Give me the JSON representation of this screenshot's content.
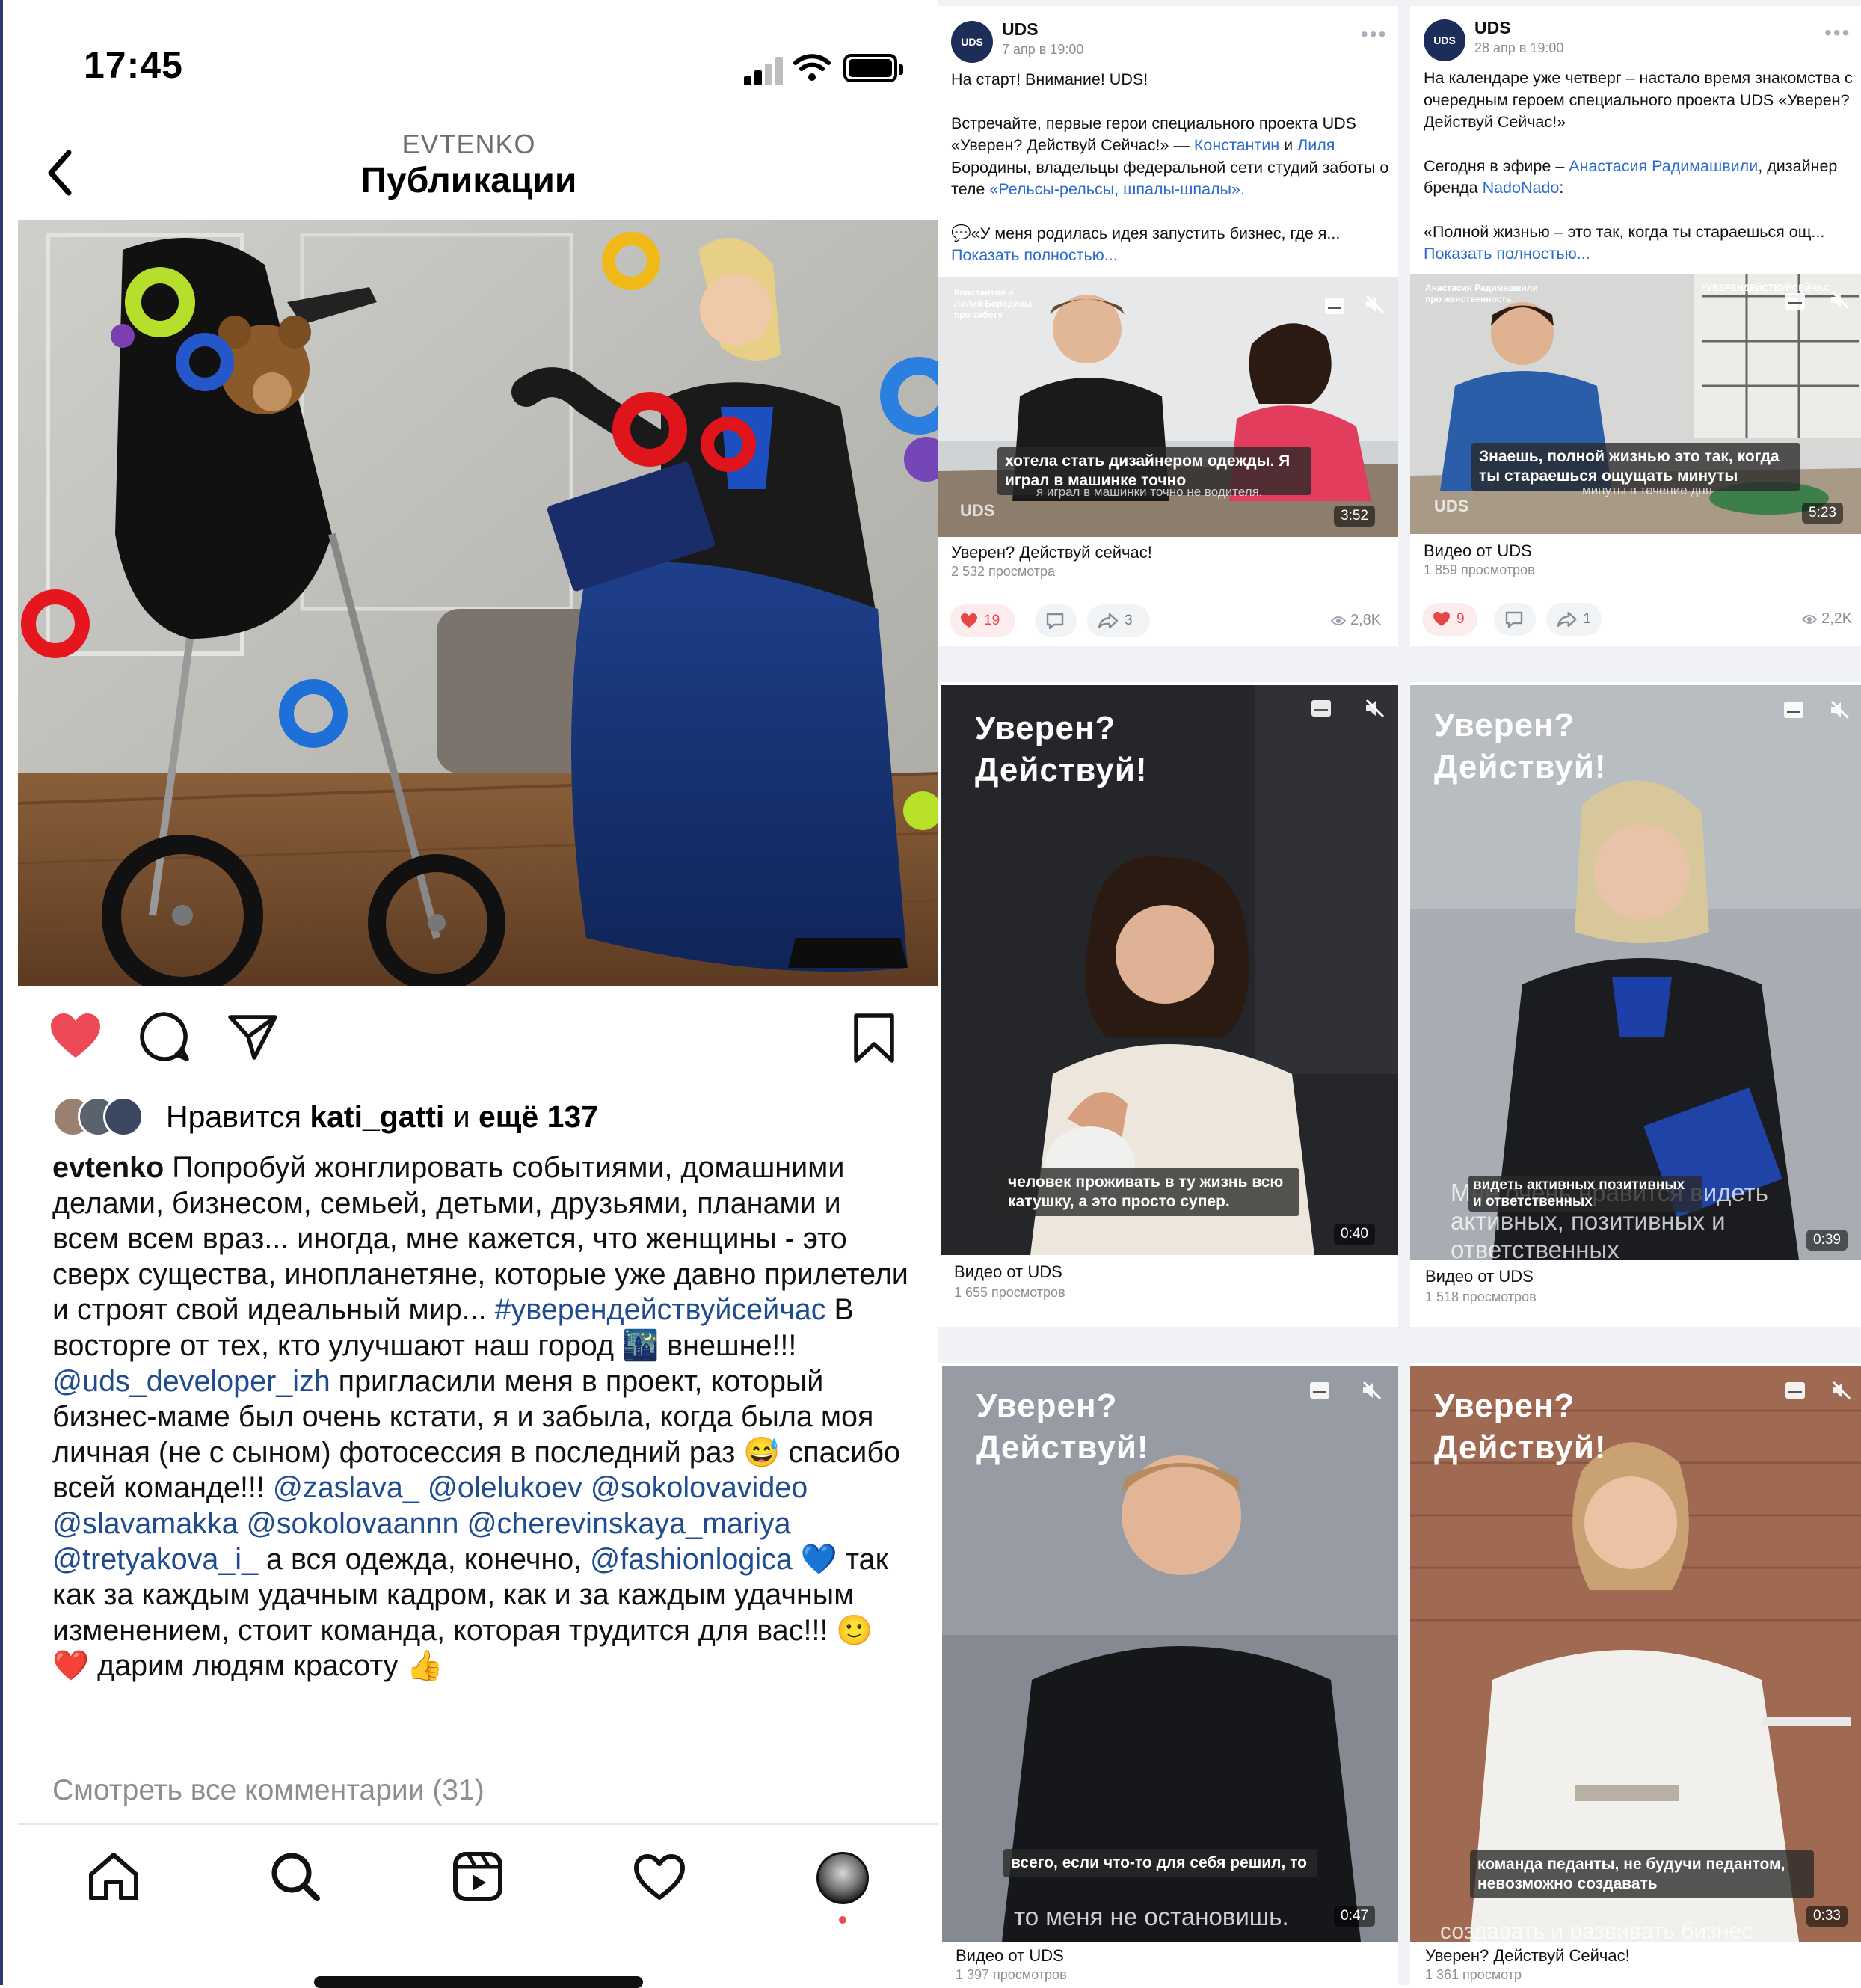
{
  "status_bar": {
    "time": "17:45"
  },
  "header": {
    "username": "EVTENKO",
    "title": "Публикации"
  },
  "post": {
    "likes_prefix": "Нравится ",
    "likes_user": "kati_gatti",
    "likes_mid": " и ",
    "likes_more": "ещё 137",
    "caption": {
      "author": "evtenko",
      "p1": " Попробуй жонглировать событиями, домашними делами, бизнесом, семьей, детьми, друзьями, планами и всем всем враз... иногда, мне кажется, что женщины - это сверх существа, инопланетяне, которые уже давно прилетели и строят свой идеальный мир... ",
      "hashtag": "#уверендействуйсейчас",
      "p2": " В восторге от тех, кто улучшают наш город 🌃 внешне!!! ",
      "m1": "@uds_developer_izh",
      "p3": " пригласили меня в проект, который бизнес-маме был очень кстати, я и забыла, когда была моя личная (не с сыном) фотосессия в последний раз 😅 спасибо всей команде!!! ",
      "m2": "@zaslava_",
      "m3": "@olelukoev",
      "m4": "@sokolovavideo",
      "m5": "@slavamakka",
      "m6": "@sokolovaannn",
      "m7": "@cherevinskaya_mariya",
      "m8": "@tretyakova_i_",
      "p4": " а вся одежда, конечно, ",
      "m9": "@fashionlogica",
      "p5": " 💙 так как за каждым удачным кадром, как и за каждым удачным изменением, стоит команда, которая трудится для вас!!! 🙂 ❤️ дарим людям красоту 👍"
    },
    "view_comments": "Смотреть все комментарии (31)"
  },
  "feed": {
    "post1": {
      "author": "UDS",
      "avatar": "UDS",
      "date": "7 апр в 19:00",
      "line1": "На старт! Внимание! UDS!",
      "t1": "Встречайте, первые герои специального проекта UDS «Уверен? Действуй Сейчас!» — ",
      "l1": "Константин",
      "t2": " и ",
      "l2": "Лиля",
      "t3": " Бородины, владельцы федеральной сети студий заботы о теле ",
      "l3": "«Рельсы-рельсы, шпалы-шпалы».",
      "quote": "💬«У меня родилась идея запустить бизнес, где я...",
      "more": "Показать полностью...",
      "thumb_tag": "Константин и Лилия Бородины про заботу",
      "subtitle": "хотела стать дизайнером одежды. Я играл в машинке точно",
      "subtitle2": "я играл в машинки точно не водителя.",
      "duration": "3:52",
      "video_title": "Уверен? Действуй сейчас!",
      "video_views": "2 532 просмотра",
      "likes": "19",
      "comments": "",
      "shares": "3",
      "views": "2,8K"
    },
    "post2": {
      "author": "UDS",
      "avatar": "UDS",
      "date": "28 апр в 19:00",
      "t1": "На календаре уже четверг – настало время знакомства с очередным героем специального проекта UDS «Уверен? Действуй Сейчас!»",
      "t2": "Сегодня в эфире – ",
      "l1": "Анастасия Радимашвили",
      "t3": ", дизайнер бренда ",
      "l2": "NadoNado",
      "t4": ":",
      "quote": "«Полной жизнью – это так, когда ты стараешься ощ...",
      "more": "Показать полностью...",
      "thumb_tag": "Анастасия Радимашвили про женственность",
      "thumb_tag2": "#УВЕРЕНДЕЙСТВУЙСЕЙЧАС",
      "subtitle": "Знаешь, полной жизнью это так, когда ты стараешься ощущать минуты",
      "subtitle2": "минуты в течение дня",
      "duration": "5:23",
      "video_title": "Видео от UDS",
      "video_views": "1 859 просмотров",
      "likes": "9",
      "comments": "",
      "shares": "1",
      "views": "2,2K"
    },
    "video3": {
      "overlay": "Уверен?\nДействуй!",
      "subtitle": "человек проживать в ту жизнь всю катушку, а это просто супер.",
      "duration": "0:40",
      "title": "Видео от UDS",
      "views": "1 655 просмотров"
    },
    "video4": {
      "overlay": "Уверен?\nДействуй!",
      "subtitle": "видеть активных позитивных и ответственных",
      "subtitle_big": "Мне очень нравится видеть активных, позитивных и ответственных",
      "duration": "0:39",
      "title": "Видео от UDS",
      "views": "1 518 просмотров"
    },
    "video5": {
      "overlay": "Уверен?\nДействуй!",
      "subtitle": "всего, если что-то для себя решил, то",
      "subtitle_big": "то меня не остановишь.",
      "duration": "0:47",
      "title": "Видео от UDS",
      "views": "1 397 просмотров"
    },
    "video6": {
      "overlay": "Уверен?\nДействуй!",
      "subtitle": "команда педанты, не будучи педантом, невозможно создавать",
      "subtitle_big": "создавать и развивать бизнес",
      "duration": "0:33",
      "title": "Уверен? Действуй Сейчас!",
      "views": "1 361 просмотр"
    }
  },
  "colors": {
    "like_red": "#ed4956",
    "link_blue": "#1f4c8f",
    "vk_link": "#2a6bcb"
  }
}
